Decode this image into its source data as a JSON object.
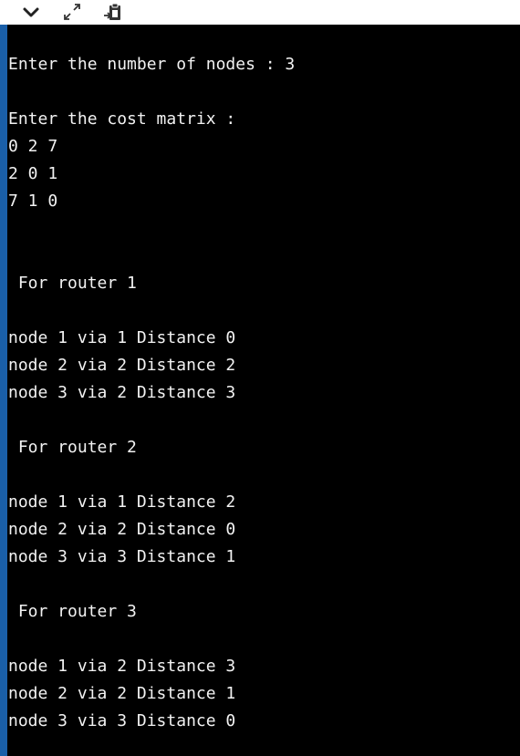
{
  "toolbar": {
    "buttons": [
      {
        "icon": "chevron-down-icon"
      },
      {
        "icon": "expand-icon"
      },
      {
        "icon": "clipboard-export-icon"
      }
    ]
  },
  "console": {
    "lines": [
      "Enter the number of nodes : 3",
      "Enter the cost matrix :",
      "0 2 7",
      "2 0 1",
      "7 1 0",
      " For router 1",
      "node 1 via 1 Distance 0",
      "node 2 via 2 Distance 2",
      "node 3 via 2 Distance 3",
      " For router 2",
      "node 1 via 1 Distance 2",
      "node 2 via 2 Distance 0",
      "node 3 via 3 Distance 1",
      " For router 3",
      "node 1 via 2 Distance 3",
      "node 2 via 2 Distance 1",
      "node 3 via 3 Distance 0"
    ]
  }
}
